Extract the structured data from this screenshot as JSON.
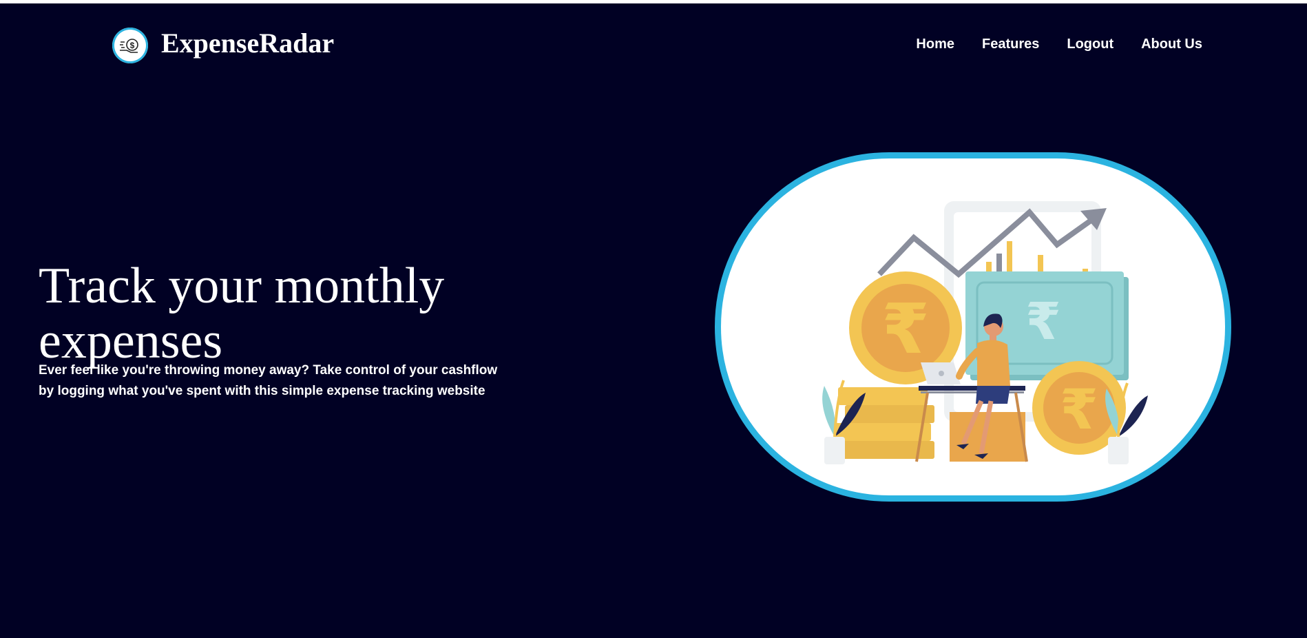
{
  "header": {
    "brand": "ExpenseRadar",
    "logo_icon": "money-hand-icon",
    "nav": [
      {
        "label": "Home"
      },
      {
        "label": "Features"
      },
      {
        "label": "Logout"
      },
      {
        "label": "About Us"
      }
    ]
  },
  "hero": {
    "title": "Track your monthly expenses",
    "subtitle": "Ever feel like you're throwing money away? Take control of your cashflow by logging what you've spent with this simple expense tracking website",
    "illustration": "finance-woman-laptop-illustration",
    "coin_symbol": "₹"
  },
  "colors": {
    "background": "#010124",
    "accent": "#2bb3e0",
    "coin": "#f3c553",
    "bill": "#94d3d4"
  }
}
